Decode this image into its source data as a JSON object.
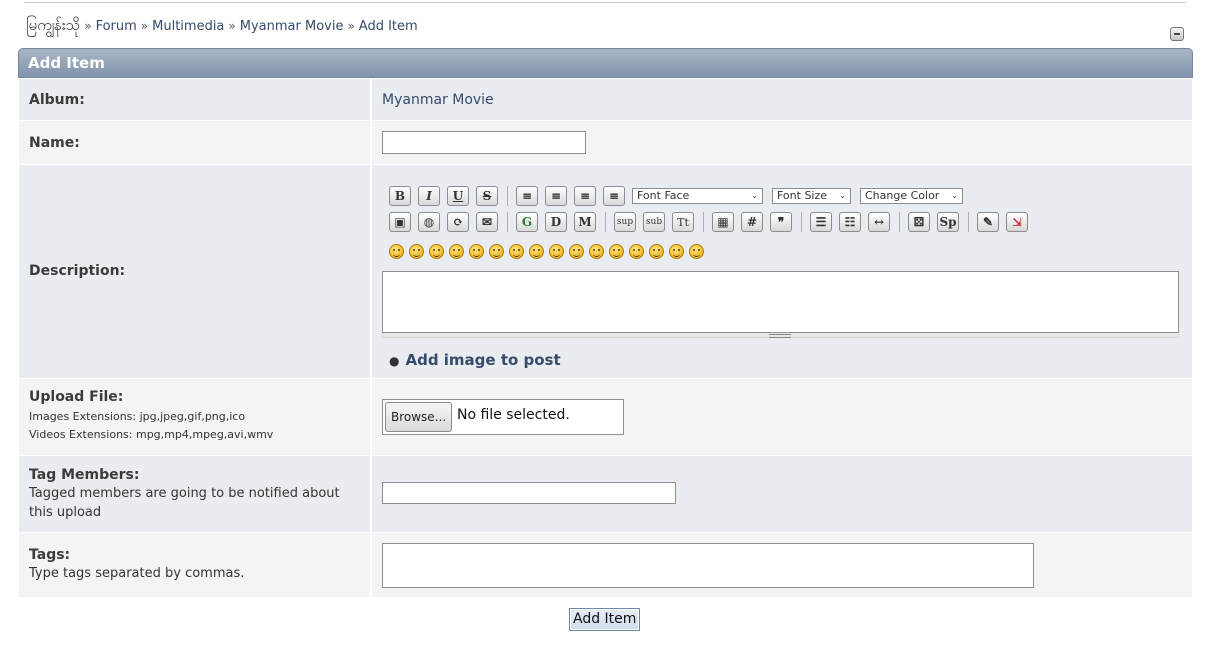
{
  "breadcrumb": {
    "home": "မြကျွန်းသို",
    "items": [
      "Forum",
      "Multimedia",
      "Myanmar Movie",
      "Add Item"
    ],
    "separator": "»"
  },
  "header": {
    "title": "Add Item"
  },
  "form": {
    "album": {
      "label": "Album:",
      "value": "Myanmar Movie"
    },
    "name": {
      "label": "Name:",
      "value": ""
    },
    "description": {
      "label": "Description:",
      "toolbar": {
        "bold": "B",
        "italic": "I",
        "underline": "U",
        "strike": "S",
        "font_face": "Font Face",
        "font_size": "Font Size",
        "change_color": "Change Color",
        "google": "G",
        "youtube": "D",
        "more": "M",
        "sup": "sup",
        "sub": "sub",
        "tt": "Tt",
        "hash": "#",
        "spoiler": "Sp",
        "smiley_count": 16
      },
      "value": "",
      "add_image": "Add image to post"
    },
    "upload": {
      "label": "Upload File:",
      "images_ext": "Images Extensions: jpg,jpeg,gif,png,ico",
      "videos_ext": "Videos Extensions: mpg,mp4,mpeg,avi,wmv",
      "browse": "Browse...",
      "no_file": "No file selected."
    },
    "tag_members": {
      "label": "Tag Members:",
      "desc": "Tagged members are going to be notified about this upload",
      "value": ""
    },
    "tags": {
      "label": "Tags:",
      "desc": "Type tags separated by commas.",
      "value": ""
    },
    "submit": "Add Item"
  },
  "colors": {
    "header_top": "#a9b6c6",
    "header_bottom": "#8193ab",
    "link": "#364b6a",
    "row_odd": "#e9ecf0",
    "row_even": "#f2f4f6"
  }
}
